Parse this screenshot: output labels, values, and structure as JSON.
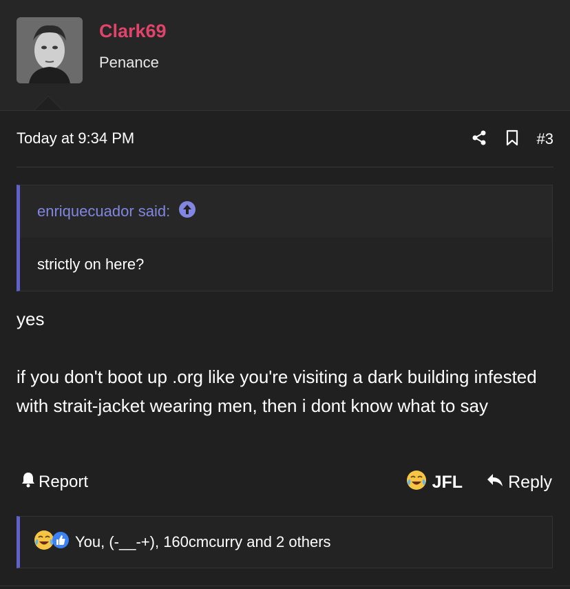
{
  "user": {
    "name": "Clark69",
    "title": "Penance",
    "name_color": "#e0446b"
  },
  "post": {
    "timestamp": "Today at 9:34 PM",
    "number": "#3",
    "icons": [
      "share-icon",
      "bookmark-icon"
    ]
  },
  "quote": {
    "author_line": "enriquecuador said:",
    "text": "strictly on here?",
    "accent": "#5f63c9"
  },
  "message": {
    "line1": "yes",
    "line2": "if you don't boot up .org like you're visiting a dark building infested with strait-jacket wearing men, then i dont know what to say"
  },
  "actions": {
    "report": "Report",
    "react": "JFL",
    "reply": "Reply"
  },
  "reactions": {
    "summary": "You, (-__-+), 160cmcurry and 2 others",
    "icons": [
      "crying-laughing-emoji-icon",
      "thumbs-up-icon"
    ]
  }
}
